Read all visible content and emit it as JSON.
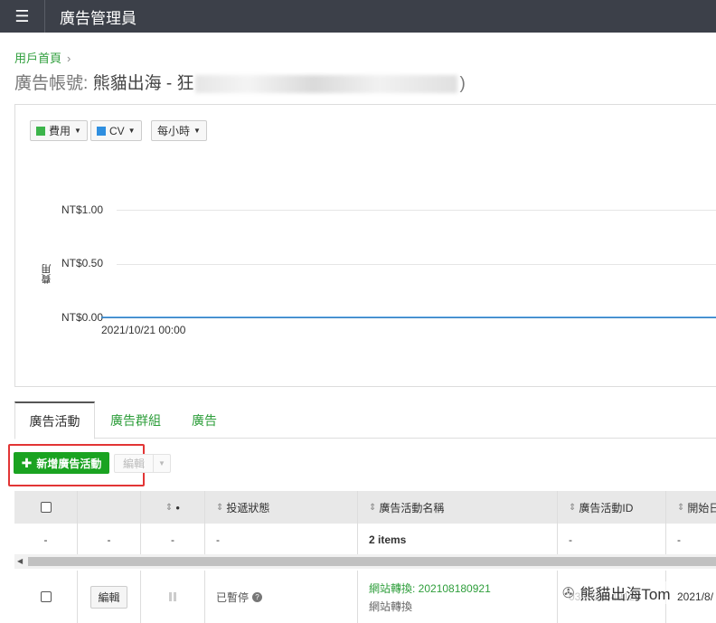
{
  "app": {
    "title": "廣告管理員"
  },
  "breadcrumb": {
    "home": "用戶首頁",
    "separator": "›"
  },
  "account": {
    "label": "廣告帳號:",
    "name": "熊貓出海 - 狂",
    "close": ")"
  },
  "chart_controls": {
    "metric1": "費用",
    "metric2": "CV",
    "interval": "每小時"
  },
  "colors": {
    "metric1": "#3cb44b",
    "metric2": "#2f8fe0",
    "accent": "#1aa321",
    "highlight": "#e23535"
  },
  "chart_data": {
    "type": "line",
    "ylabel": "費用",
    "y_ticks": [
      "NT$1.00",
      "NT$0.50",
      "NT$0.00"
    ],
    "ylim": [
      0,
      1.0
    ],
    "x_tick": "2021/10/21 00:00",
    "series": [
      {
        "values": [
          0,
          0
        ]
      }
    ]
  },
  "tabs": [
    "廣告活動",
    "廣告群組",
    "廣告"
  ],
  "toolbar": {
    "add_label": "新增廣告活動",
    "edit_label": "編輯"
  },
  "table": {
    "headers": [
      "",
      "",
      "",
      "●",
      "投遞狀態",
      "廣告活動名稱",
      "廣告活動ID",
      "開始日"
    ],
    "summary": [
      "-",
      "-",
      "-",
      "-",
      "2 items",
      "-",
      "-"
    ],
    "row": {
      "edit": "編輯",
      "status": "已暫停",
      "name_link": "網站轉換: 202108180921",
      "name_sub": "網站轉換",
      "id": "038823349126",
      "start": "2021/8/"
    }
  },
  "watermark": "熊貓出海Tom"
}
